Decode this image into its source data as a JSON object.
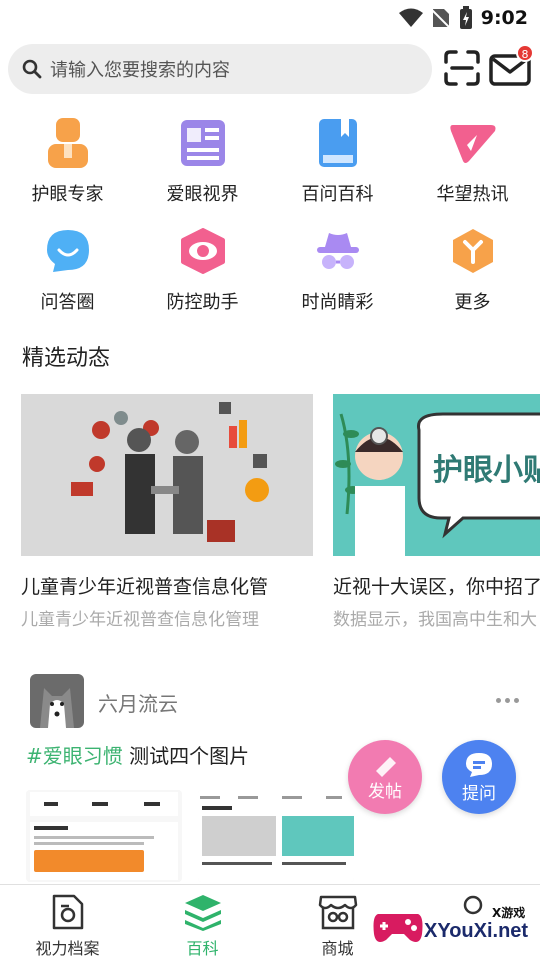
{
  "status": {
    "time": "9:02"
  },
  "search": {
    "placeholder": "请输入您要搜索的内容"
  },
  "mail": {
    "badge": "8"
  },
  "grid": [
    {
      "label": "护眼专家",
      "icon": "doctor-icon",
      "color": "#f7a24a"
    },
    {
      "label": "爱眼视界",
      "icon": "news-icon",
      "color": "#9b86e8"
    },
    {
      "label": "百问百科",
      "icon": "book-icon",
      "color": "#4a9df0"
    },
    {
      "label": "华望热讯",
      "icon": "send-icon",
      "color": "#f2608f"
    },
    {
      "label": "问答圈",
      "icon": "chat-bubble-icon",
      "color": "#4fb0f5"
    },
    {
      "label": "防控助手",
      "icon": "eye-icon",
      "color": "#f2608f"
    },
    {
      "label": "时尚睛彩",
      "icon": "incognito-icon",
      "color": "#a98af2"
    },
    {
      "label": "更多",
      "icon": "more-icon",
      "color": "#f7a24a"
    }
  ],
  "section": {
    "title": "精选动态"
  },
  "cards": [
    {
      "title": "儿童青少年近视普查信息化管",
      "subtitle": "儿童青少年近视普查信息化管理"
    },
    {
      "title": "近视十大误区，你中招了",
      "subtitle": "数据显示，我国高中生和大"
    }
  ],
  "post": {
    "username": "六月流云",
    "tag": "#爱眼习惯",
    "text": " 测试四个图片"
  },
  "fab": {
    "post": "发帖",
    "ask": "提问"
  },
  "tabs": [
    {
      "label": "视力档案",
      "icon": "archive-icon"
    },
    {
      "label": "百科",
      "icon": "layers-icon"
    },
    {
      "label": "商城",
      "icon": "shop-icon"
    },
    {
      "label": "",
      "icon": "user-icon"
    }
  ],
  "colors": {
    "accent": "#2fb36b",
    "tag": "#3cb371"
  }
}
